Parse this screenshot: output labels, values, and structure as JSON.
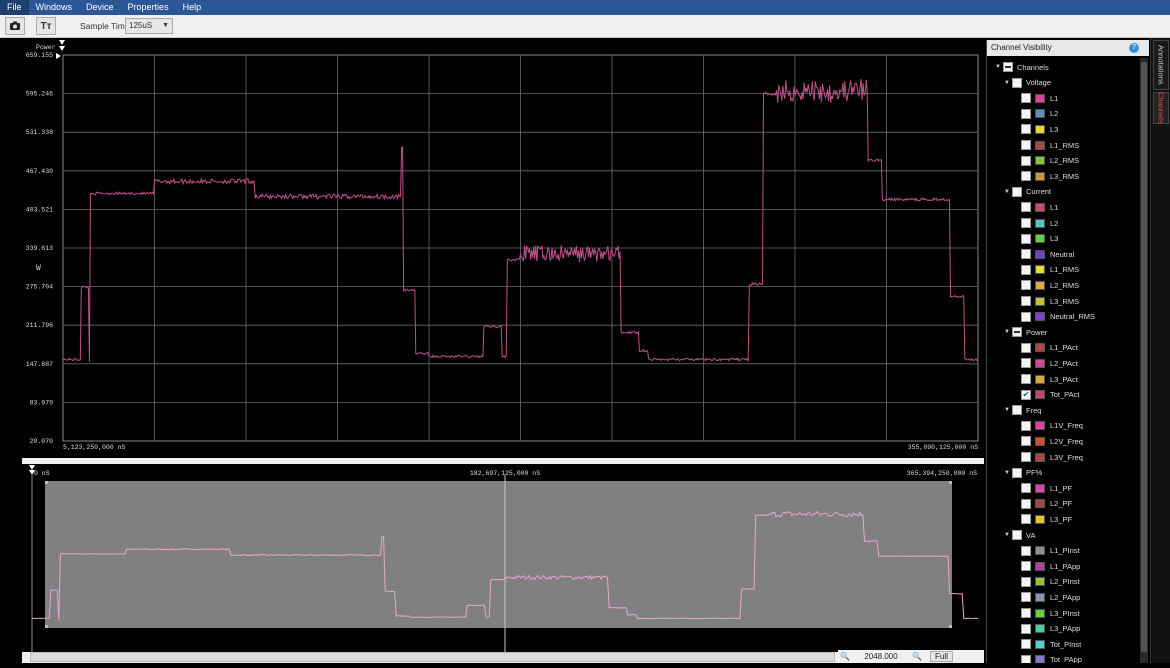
{
  "menu": [
    "File",
    "Windows",
    "Device",
    "Properties",
    "Help"
  ],
  "toolbar": {
    "sample_time_label": "Sample Time:",
    "sample_time_value": "125uS",
    "camera_icon": "camera-icon",
    "text_icon": "Tт"
  },
  "main_chart": {
    "title": "Power",
    "unit_label": "W",
    "y_ticks": [
      "659.155",
      "595.246",
      "531.338",
      "467.430",
      "403.521",
      "339.613",
      "275.704",
      "211.796",
      "147.887",
      "83.979",
      "20.070"
    ],
    "x_start_label": "5,123,250,000 nS",
    "x_end_label": "355,090,125,000 nS",
    "line_color": "#c0508a"
  },
  "overview": {
    "start_label": "0 nS",
    "mid_label": "182,697,125,000 nS",
    "end_label": "365,394,250,000 nS",
    "line_color": "#e6a6cc"
  },
  "sidebar": {
    "title": "Channel Visibility",
    "root": "Channels",
    "groups": [
      {
        "name": "Voltage",
        "state": "unchecked",
        "channels": [
          {
            "name": "L1",
            "color": "#e0409c",
            "checked": false
          },
          {
            "name": "L2",
            "color": "#5b8fbf",
            "checked": false
          },
          {
            "name": "L3",
            "color": "#e8d830",
            "checked": false
          },
          {
            "name": "L1_RMS",
            "color": "#a84848",
            "checked": false
          },
          {
            "name": "L2_RMS",
            "color": "#88c040",
            "checked": false
          },
          {
            "name": "L3_RMS",
            "color": "#c89838",
            "checked": false
          }
        ]
      },
      {
        "name": "Current",
        "state": "unchecked",
        "channels": [
          {
            "name": "L1",
            "color": "#c84878",
            "checked": false
          },
          {
            "name": "L2",
            "color": "#50c8c0",
            "checked": false
          },
          {
            "name": "L3",
            "color": "#60d040",
            "checked": false
          },
          {
            "name": "Neutral",
            "color": "#7040c0",
            "checked": false
          },
          {
            "name": "L1_RMS",
            "color": "#e0e030",
            "checked": false
          },
          {
            "name": "L2_RMS",
            "color": "#e0a840",
            "checked": false
          },
          {
            "name": "L3_RMS",
            "color": "#c8c030",
            "checked": false
          },
          {
            "name": "Neutral_RMS",
            "color": "#8040d0",
            "checked": false
          }
        ]
      },
      {
        "name": "Power",
        "state": "partial",
        "channels": [
          {
            "name": "L1_PAct",
            "color": "#a84848",
            "checked": false
          },
          {
            "name": "L2_PAct",
            "color": "#d04898",
            "checked": false
          },
          {
            "name": "L3_PAct",
            "color": "#d8a840",
            "checked": false
          },
          {
            "name": "Tot_PAct",
            "color": "#c04878",
            "checked": true
          }
        ]
      },
      {
        "name": "Freq",
        "state": "unchecked",
        "channels": [
          {
            "name": "L1V_Freq",
            "color": "#e040a0",
            "checked": false
          },
          {
            "name": "L2V_Freq",
            "color": "#d05030",
            "checked": false
          },
          {
            "name": "L3V_Freq",
            "color": "#a84848",
            "checked": false
          }
        ]
      },
      {
        "name": "PF%",
        "state": "unchecked",
        "channels": [
          {
            "name": "L1_PF",
            "color": "#e040a8",
            "checked": false
          },
          {
            "name": "L2_PF",
            "color": "#a04848",
            "checked": false
          },
          {
            "name": "L3_PF",
            "color": "#e8c830",
            "checked": false
          }
        ]
      },
      {
        "name": "VA",
        "state": "unchecked",
        "channels": [
          {
            "name": "L1_PInst",
            "color": "#909090",
            "checked": false
          },
          {
            "name": "L1_PApp",
            "color": "#b040a0",
            "checked": false
          },
          {
            "name": "L2_PInst",
            "color": "#98c040",
            "checked": false
          },
          {
            "name": "L2_PApp",
            "color": "#8898a8",
            "checked": false
          },
          {
            "name": "L3_PInst",
            "color": "#60d040",
            "checked": false
          },
          {
            "name": "L3_PApp",
            "color": "#50c8a0",
            "checked": false
          },
          {
            "name": "Tot_PInst",
            "color": "#50d0d0",
            "checked": false
          },
          {
            "name": "Tot_PApp",
            "color": "#8878c8",
            "checked": false
          }
        ]
      }
    ]
  },
  "right_tabs": [
    "Annotations",
    "Channels"
  ],
  "bottom": {
    "zoom_value": "2048.000",
    "full_label": "Full"
  }
}
